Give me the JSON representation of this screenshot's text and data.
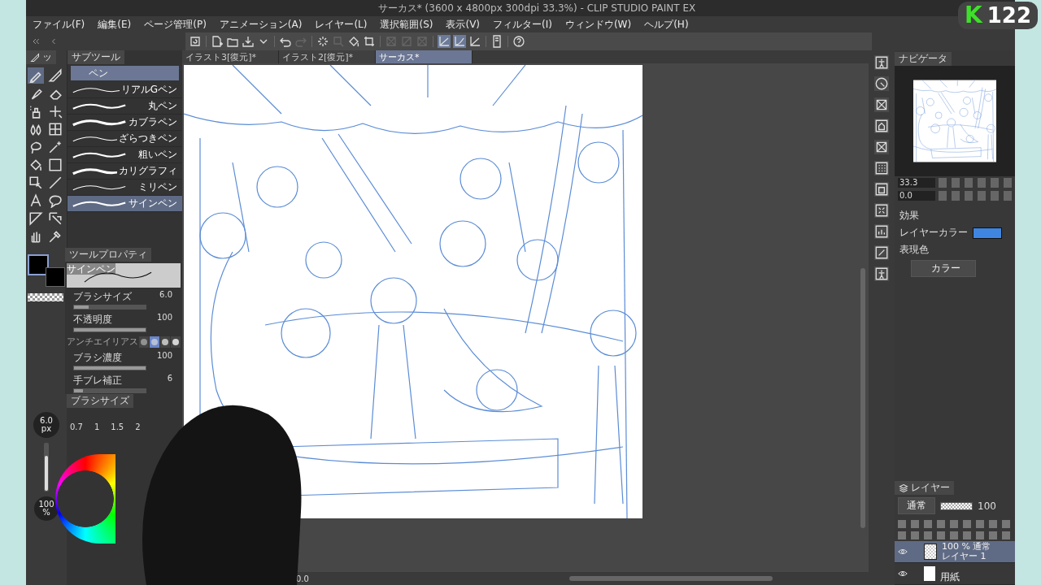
{
  "window": {
    "title": "サーカス* (3600 x 4800px 300dpi 33.3%)  - CLIP STUDIO PAINT EX"
  },
  "menu": [
    "ファイル(F)",
    "編集(E)",
    "ページ管理(P)",
    "アニメーション(A)",
    "レイヤー(L)",
    "選択範囲(S)",
    "表示(V)",
    "フィルター(I)",
    "ウィンドウ(W)",
    "ヘルプ(H)"
  ],
  "document_tabs": [
    {
      "label": "イラスト3[復元]*",
      "selected": false
    },
    {
      "label": "イラスト2[復元]*",
      "selected": false
    },
    {
      "label": "サーカス*",
      "selected": true
    }
  ],
  "tool_tab": {
    "label": "ッ"
  },
  "subtool": {
    "tab_label": "サブツール",
    "group": "ペン",
    "items": [
      {
        "label": "リアルGペン",
        "selected": false
      },
      {
        "label": "丸ペン",
        "selected": false
      },
      {
        "label": "カブラペン",
        "selected": false
      },
      {
        "label": "ざらつきペン",
        "selected": false
      },
      {
        "label": "粗いペン",
        "selected": false
      },
      {
        "label": "カリグラフィ",
        "selected": false
      },
      {
        "label": "ミリペン",
        "selected": false
      },
      {
        "label": "サインペン",
        "selected": true
      }
    ]
  },
  "tool_property": {
    "tab_label": "ツールプロパティ",
    "preview_label": "サインペン",
    "properties": [
      {
        "kind": "slider",
        "label": "ブラシサイズ",
        "value": "6.0",
        "level": 0.2
      },
      {
        "kind": "slider",
        "label": "不透明度",
        "value": "100",
        "level": 1
      },
      {
        "kind": "choice",
        "label": "アンチエイリアス",
        "options": [
          {
            "selected": false
          },
          {
            "selected": true
          },
          {
            "selected": false
          },
          {
            "selected": false
          }
        ]
      },
      {
        "kind": "slider",
        "label": "ブラシ濃度",
        "value": "100",
        "level": 1
      },
      {
        "kind": "slider",
        "label": "手ブレ補正",
        "value": "6",
        "level": 0.12
      }
    ]
  },
  "size_indicator": {
    "value": "6.0",
    "unit": "px",
    "level": 0.75
  },
  "opacity_indicator": {
    "value": "100",
    "unit": "%"
  },
  "brush_size": {
    "tab_label": "ブラシサイズ",
    "sizes": [
      "0.7",
      "1",
      "1.5",
      "2"
    ]
  },
  "canvas_status": {
    "rotation": "0.0"
  },
  "navigator": {
    "tab_label": "ナビゲータ",
    "zoom": "33.3",
    "angle": "0.0"
  },
  "layer_property": {
    "effect_label": "効果",
    "layer_color_label": "レイヤーカラー",
    "expression_label": "表現色",
    "expression_value": "カラー"
  },
  "layers": {
    "tab_label": "レイヤー",
    "blend_mode": "通常",
    "opacity": "100",
    "opacity_slider": {
      "level": 1
    },
    "items": [
      {
        "mode": "100 % 通常",
        "name": "レイヤー 1",
        "selected": true,
        "visible": true,
        "kind": "raster"
      },
      {
        "name": "用紙",
        "selected": false,
        "visible": true,
        "kind": "paper"
      }
    ]
  },
  "stream_badge": {
    "letter": "K",
    "count": "122"
  }
}
